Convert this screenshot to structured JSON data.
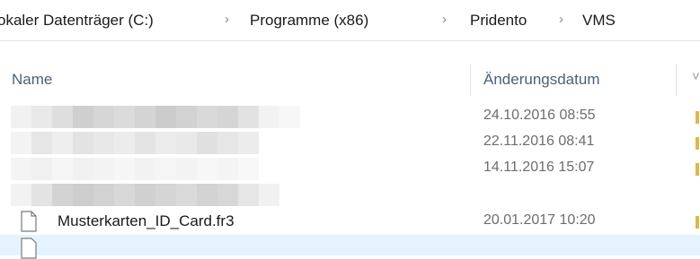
{
  "breadcrumb": [
    {
      "label": "okaler Datenträger (C:)"
    },
    {
      "label": "Programme (x86)"
    },
    {
      "label": "Pridento"
    },
    {
      "label": "VMS"
    }
  ],
  "breadcrumb_separator": "›",
  "columns": {
    "name": "Name",
    "date": "Änderungsdatum"
  },
  "files": [
    {
      "name": "",
      "date": "24.10.2016 08:55",
      "blurred": true
    },
    {
      "name": "",
      "date": "22.11.2016 08:41",
      "blurred": true
    },
    {
      "name": "",
      "date": "14.11.2016 15:07",
      "blurred": true
    },
    {
      "name": "Musterkarten_ID_Card.fr3",
      "date": "20.01.2017 10:20",
      "icon": "file-icon"
    },
    {
      "name": "",
      "date": "",
      "icon": "file-icon",
      "selected": true
    }
  ],
  "colors": {
    "header_text": "#4c607a",
    "date_text": "#6d6d6d",
    "selection": "#e5f3ff",
    "type_marker": "#e0b64a"
  }
}
